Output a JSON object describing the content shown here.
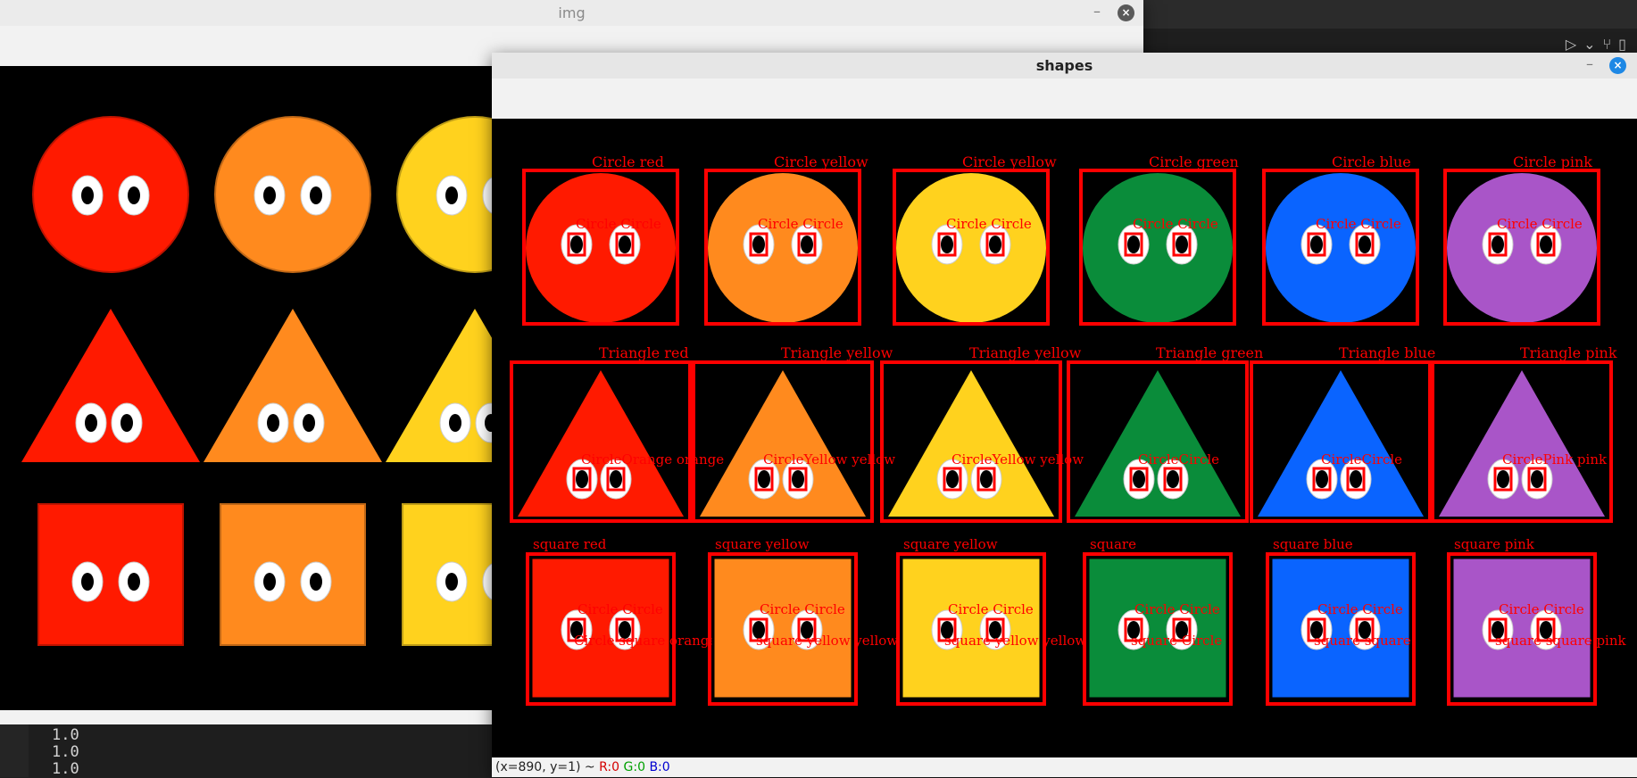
{
  "windows": {
    "img": {
      "title": "img",
      "minimize": "–",
      "close": "×"
    },
    "shapes": {
      "title": "shapes",
      "minimize": "–",
      "close": "×"
    }
  },
  "editor": {
    "toolbar_icons": "▷⌄⑂▯"
  },
  "console": {
    "lines": [
      "1.0",
      "1.0",
      "1.0"
    ]
  },
  "status": {
    "prefix": "(x=890, y=1) ~",
    "r": "R:0",
    "g": "G:0",
    "b": "B:0"
  },
  "colors": {
    "red": "#ff1a00",
    "orange": "#ff8a1e",
    "yellow": "#ffd21e",
    "green": "#0a8c3a",
    "blue": "#0a64ff",
    "pink": "#a955c8",
    "annotation": "#ff0000"
  },
  "shapes_rows": [
    "circle",
    "triangle",
    "square"
  ],
  "shapes_cols": [
    "red",
    "orange",
    "yellow",
    "green",
    "blue",
    "pink"
  ],
  "labels": {
    "circle": [
      "Circle red",
      "Circle yellow",
      "Circle yellow",
      "Circle green",
      "Circle blue",
      "Circle pink"
    ],
    "triangle": [
      "Triangle red",
      "Triangle yellow",
      "Triangle yellow",
      "Triangle green",
      "Triangle blue",
      "Triangle pink"
    ],
    "square": [
      "square red",
      "square yellow",
      "square yellow",
      "square",
      "square blue",
      "square pink"
    ],
    "eye_circle": "Circle Circle",
    "triangle_eyes": [
      "CircleOrange orange",
      "CircleYellow yellow",
      "CircleYellow yellow",
      "CircleCircle",
      "CircleCircle",
      "CirclePink pink"
    ],
    "square_eyes": [
      "Circle square orange",
      "square yellow yellow",
      "square yellow yellow",
      "square Circle",
      "square square",
      "square square pink"
    ]
  }
}
